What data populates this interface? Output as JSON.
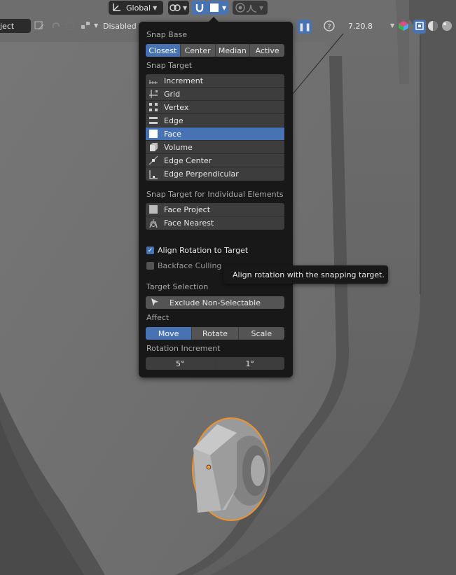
{
  "header": {
    "orientation": "Global",
    "mode_partial": "ject",
    "proportional_falloff": "Disabled",
    "version": "7.20.8"
  },
  "snap_popover": {
    "snap_base_label": "Snap Base",
    "snap_base_options": [
      "Closest",
      "Center",
      "Median",
      "Active"
    ],
    "snap_base_selected": "Closest",
    "snap_target_label": "Snap Target",
    "snap_targets": [
      {
        "label": "Increment",
        "icon": "increment-icon"
      },
      {
        "label": "Grid",
        "icon": "grid-icon"
      },
      {
        "label": "Vertex",
        "icon": "vertex-icon"
      },
      {
        "label": "Edge",
        "icon": "edge-icon"
      },
      {
        "label": "Face",
        "icon": "face-icon",
        "selected": true
      },
      {
        "label": "Volume",
        "icon": "volume-icon"
      },
      {
        "label": "Edge Center",
        "icon": "edge-center-icon"
      },
      {
        "label": "Edge Perpendicular",
        "icon": "edge-perpendicular-icon"
      }
    ],
    "individual_label": "Snap Target for Individual Elements",
    "individual_targets": [
      {
        "label": "Face Project",
        "icon": "face-project-icon"
      },
      {
        "label": "Face Nearest",
        "icon": "face-nearest-icon"
      }
    ],
    "align_rotation": {
      "label": "Align Rotation to Target",
      "checked": true
    },
    "backface_culling": {
      "label": "Backface Culling",
      "checked": false
    },
    "target_selection_label": "Target Selection",
    "exclude_label": "Exclude Non-Selectable",
    "affect_label": "Affect",
    "affect_options": [
      "Move",
      "Rotate",
      "Scale"
    ],
    "affect_selected": "Move",
    "rotation_increment_label": "Rotation Increment",
    "rotation_increments": [
      "5°",
      "1°"
    ]
  },
  "tooltip": "Align rotation with the snapping target.",
  "colors": {
    "accent": "#4772b3",
    "panel": "#181818",
    "selection_outline": "#f0922b"
  }
}
